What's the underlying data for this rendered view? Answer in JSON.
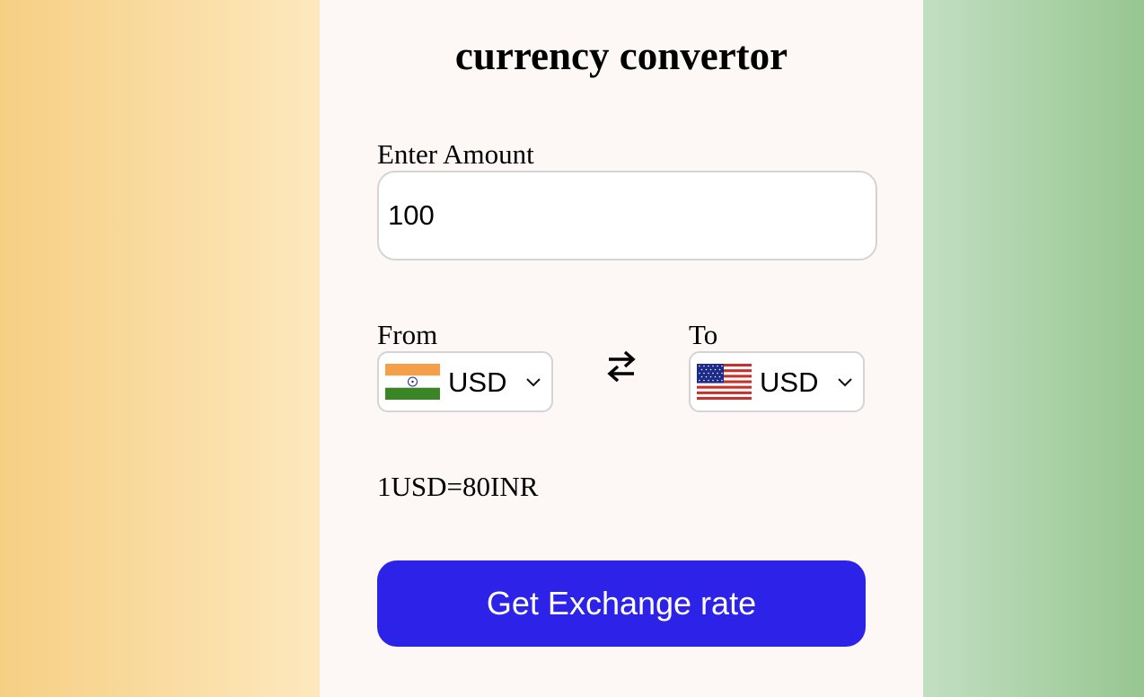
{
  "app": {
    "title": "currency convertor"
  },
  "amount": {
    "label": "Enter Amount",
    "value": "100"
  },
  "from": {
    "label": "From",
    "currency": "USD",
    "flag_icon": "india-flag-icon"
  },
  "to": {
    "label": "To",
    "currency": "USD",
    "flag_icon": "usa-flag-icon"
  },
  "swap_icon": "swap-arrows-icon",
  "rate_text": "1USD=80INR",
  "button": {
    "label": "Get Exchange rate"
  },
  "colors": {
    "button_bg": "#2c22e8",
    "left_gradient": [
      "#f6cf83",
      "#fde8be"
    ],
    "right_gradient": [
      "#c2dfc2",
      "#97c691"
    ],
    "card_bg": "#fdf8f6"
  }
}
